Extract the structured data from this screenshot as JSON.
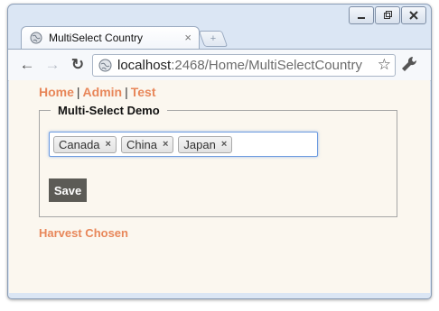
{
  "window": {
    "controls": [
      "minimize",
      "restore",
      "close"
    ]
  },
  "tab": {
    "title": "MultiSelect Country",
    "close_glyph": "×",
    "newtab_glyph": "+"
  },
  "toolbar": {
    "back_glyph": "←",
    "forward_glyph": "→",
    "reload_glyph": "↻",
    "url_host": "localhost",
    "url_path": ":2468/Home/MultiSelectCountry",
    "star_glyph": "☆"
  },
  "nav": {
    "links": [
      "Home",
      "Admin",
      "Test"
    ],
    "separator": "|"
  },
  "form": {
    "legend": "Multi-Select Demo",
    "selected": [
      "Canada",
      "China",
      "Japan"
    ],
    "remove_glyph": "×",
    "save_label": "Save"
  },
  "footer_link": "Harvest Chosen",
  "colors": {
    "link": "#e8875a",
    "page_bg": "#fbf7ef",
    "save_button": "#5c5b56",
    "focus_border": "#6d9be0"
  }
}
